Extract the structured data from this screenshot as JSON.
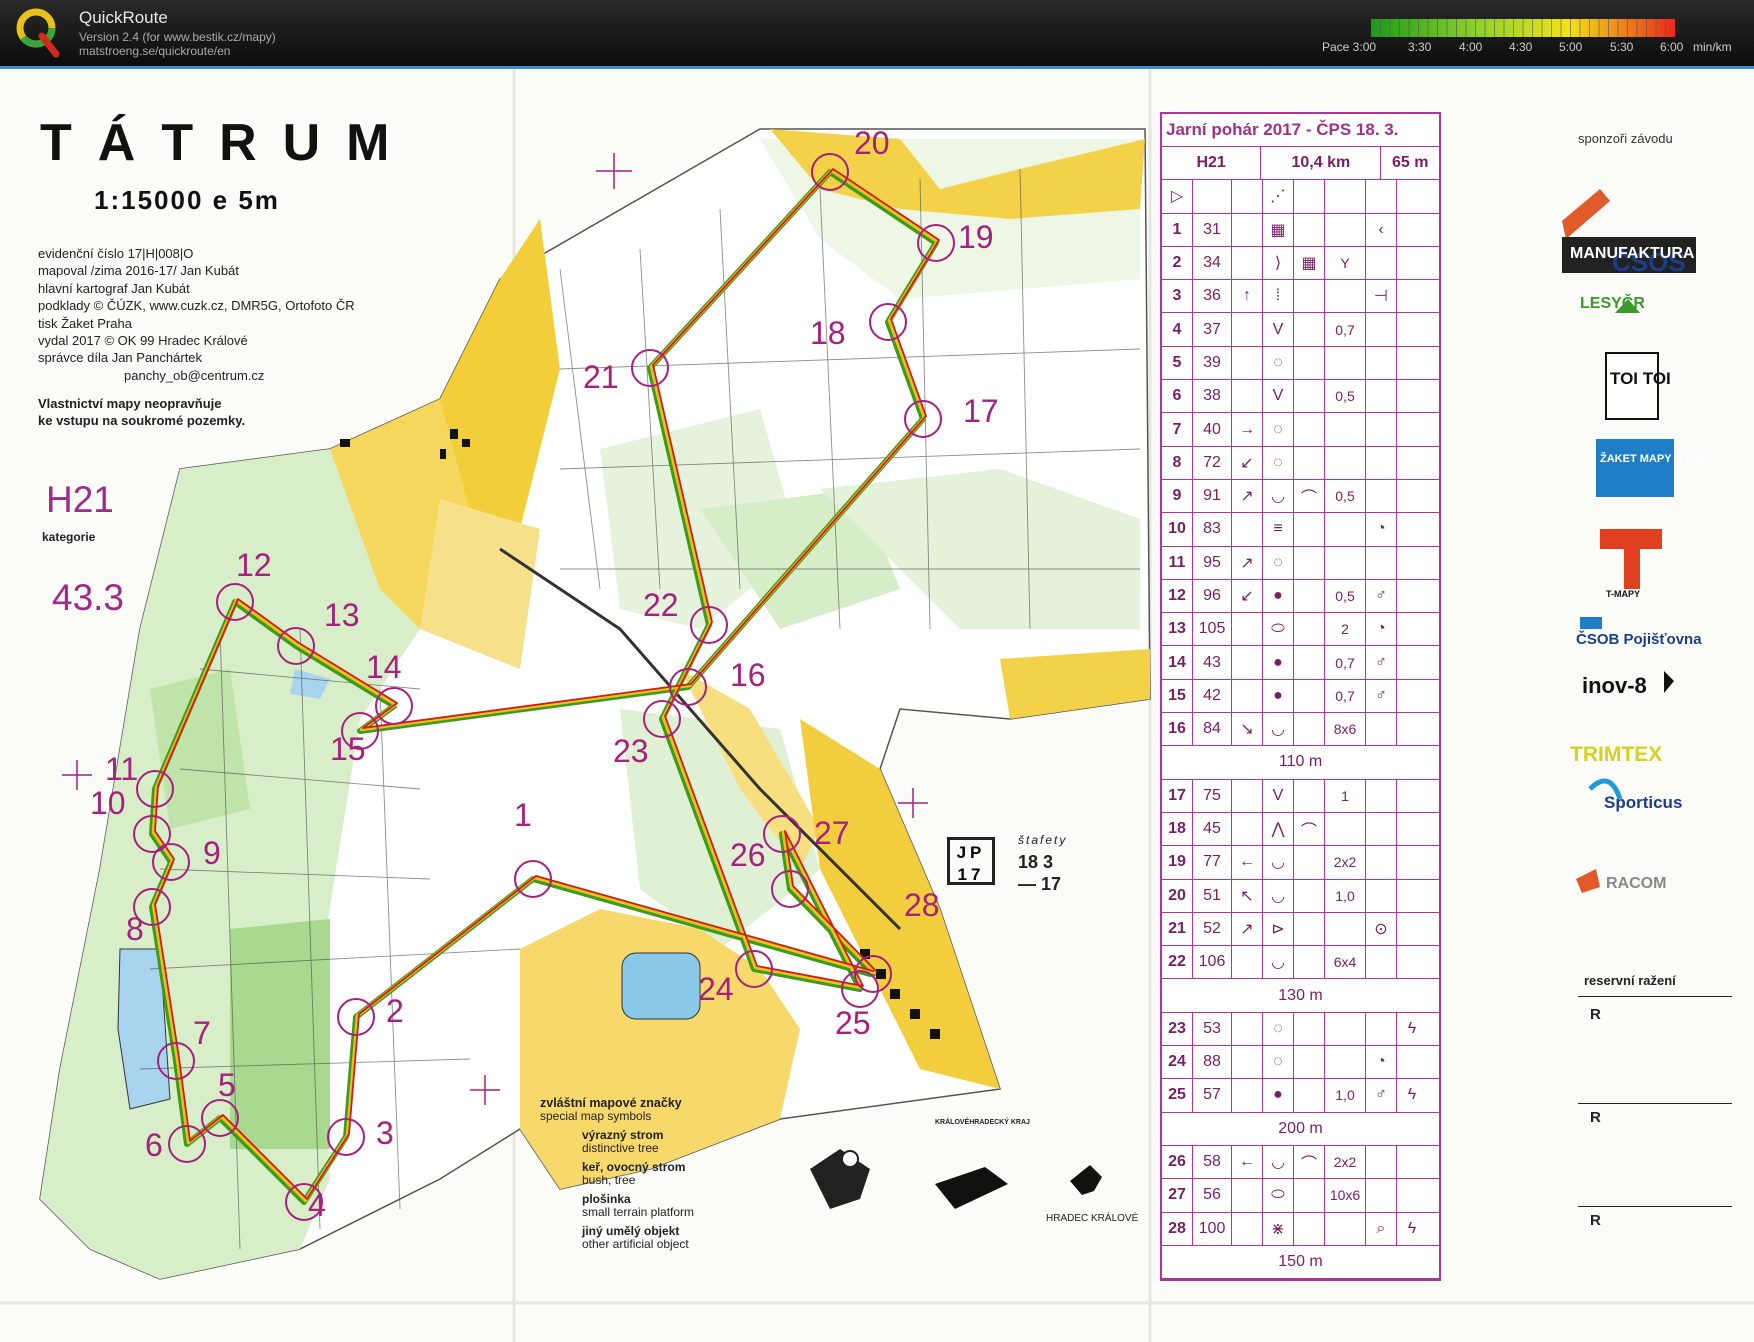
{
  "app": {
    "name": "QuickRoute",
    "version": "Version 2.4  (for www.bestik.cz/mapy)",
    "url": "matstroeng.se/quickroute/en",
    "pace_labels": [
      "Pace 3:00",
      "3:30",
      "4:00",
      "4:30",
      "5:00",
      "5:30",
      "6:00",
      "min/km"
    ]
  },
  "map": {
    "title": "TÁTRUM",
    "scale": "1:15000  e 5m",
    "credits": [
      "evidenční číslo 17|H|008|O",
      "mapoval /zima 2016-17/ Jan Kubát",
      "hlavní kartograf Jan Kubát",
      "podklady © ČÚZK, www.cuzk.cz, DMR5G, Ortofoto ČR",
      "tisk Žaket Praha",
      "vydal 2017  © OK 99 Hradec Králové",
      "správce díla  Jan Panchártek",
      "panchy_ob@centrum.cz"
    ],
    "warning": [
      "Vlastnictví mapy neopravňuje",
      "ke vstupu na soukromé pozemky."
    ],
    "category": "H21",
    "category_label": "kategorie",
    "time_value": "43.3",
    "control_numbers": [
      "1",
      "2",
      "3",
      "4",
      "5",
      "6",
      "7",
      "8",
      "9",
      "10",
      "11",
      "12",
      "13",
      "14",
      "15",
      "16",
      "17",
      "18",
      "19",
      "20",
      "21",
      "22",
      "23",
      "24",
      "25",
      "26",
      "27",
      "28"
    ],
    "jp_box": [
      "JP",
      "17"
    ],
    "stafety": [
      "štafety",
      "18  3",
      "—  17"
    ]
  },
  "legend": {
    "title": "zvláštní mapové značky",
    "subtitle": "special map symbols",
    "items": [
      {
        "cz": "výrazný strom",
        "en": "distinctive tree"
      },
      {
        "cz": "keř, ovocný strom",
        "en": "bush, tree"
      },
      {
        "cz": "plošinka",
        "en": "small terrain platform"
      },
      {
        "cz": "jiný umělý objekt",
        "en": "other artificial object"
      }
    ],
    "logo_captions": [
      "KRÁLOVÉHRADECKÝ KRAJ",
      "HRADEC KRÁLOVÉ"
    ]
  },
  "description_sheet": {
    "title": "Jarní pohár 2017 - ČPS 18. 3.",
    "category": "H21",
    "length": "10,4 km",
    "climb": "65 m",
    "rows": [
      {
        "n": "1",
        "code": "31",
        "c": "",
        "d": "▦",
        "e": "",
        "f": "",
        "g": "‹",
        "h": ""
      },
      {
        "n": "2",
        "code": "34",
        "c": "",
        "d": "⟩",
        "e": "▦",
        "f": "Y",
        "g": "",
        "h": ""
      },
      {
        "n": "3",
        "code": "36",
        "c": "↑",
        "d": "⁞",
        "e": "",
        "f": "",
        "g": "⊣",
        "h": ""
      },
      {
        "n": "4",
        "code": "37",
        "c": "",
        "d": "V",
        "e": "",
        "f": "0,7",
        "g": "",
        "h": ""
      },
      {
        "n": "5",
        "code": "39",
        "c": "",
        "d": "◌",
        "e": "",
        "f": "",
        "g": "",
        "h": ""
      },
      {
        "n": "6",
        "code": "38",
        "c": "",
        "d": "V",
        "e": "",
        "f": "0,5",
        "g": "",
        "h": ""
      },
      {
        "n": "7",
        "code": "40",
        "c": "→",
        "d": "◌",
        "e": "",
        "f": "",
        "g": "",
        "h": ""
      },
      {
        "n": "8",
        "code": "72",
        "c": "↙",
        "d": "◌",
        "e": "",
        "f": "",
        "g": "",
        "h": ""
      },
      {
        "n": "9",
        "code": "91",
        "c": "↗",
        "d": "◡",
        "e": "⌒",
        "f": "0,5",
        "g": "",
        "h": ""
      },
      {
        "n": "10",
        "code": "83",
        "c": "",
        "d": "≡",
        "e": "",
        "f": "",
        "g": "◔",
        "h": ""
      },
      {
        "n": "11",
        "code": "95",
        "c": "↗",
        "d": "◌",
        "e": "",
        "f": "",
        "g": "",
        "h": ""
      },
      {
        "n": "12",
        "code": "96",
        "c": "↙",
        "d": "●",
        "e": "",
        "f": "0,5",
        "g": "♂",
        "h": ""
      },
      {
        "n": "13",
        "code": "105",
        "c": "",
        "d": "⬭",
        "e": "",
        "f": "2",
        "g": "◔",
        "h": ""
      },
      {
        "n": "14",
        "code": "43",
        "c": "",
        "d": "●",
        "e": "",
        "f": "0,7",
        "g": "♂",
        "h": ""
      },
      {
        "n": "15",
        "code": "42",
        "c": "",
        "d": "●",
        "e": "",
        "f": "0,7",
        "g": "♂",
        "h": ""
      },
      {
        "n": "16",
        "code": "84",
        "c": "↘",
        "d": "◡",
        "e": "",
        "f": "8x6",
        "g": "",
        "h": ""
      },
      {
        "n": "",
        "code": "",
        "dist": "110 m"
      },
      {
        "n": "17",
        "code": "75",
        "c": "",
        "d": "V",
        "e": "",
        "f": "1",
        "g": "",
        "h": ""
      },
      {
        "n": "18",
        "code": "45",
        "c": "",
        "d": "⋀",
        "e": "⌒",
        "f": "",
        "g": "",
        "h": ""
      },
      {
        "n": "19",
        "code": "77",
        "c": "←",
        "d": "◡",
        "e": "",
        "f": "2x2",
        "g": "",
        "h": ""
      },
      {
        "n": "20",
        "code": "51",
        "c": "↖",
        "d": "◡",
        "e": "",
        "f": "1,0",
        "g": "",
        "h": ""
      },
      {
        "n": "21",
        "code": "52",
        "c": "↗",
        "d": "⊳",
        "e": "",
        "f": "",
        "g": "⊙",
        "h": ""
      },
      {
        "n": "22",
        "code": "106",
        "c": "",
        "d": "◡",
        "e": "",
        "f": "6x4",
        "g": "",
        "h": ""
      },
      {
        "n": "",
        "code": "",
        "dist": "130 m"
      },
      {
        "n": "23",
        "code": "53",
        "c": "",
        "d": "◌",
        "e": "",
        "f": "",
        "g": "",
        "h": "ϟ"
      },
      {
        "n": "24",
        "code": "88",
        "c": "",
        "d": "◌",
        "e": "",
        "f": "",
        "g": "◔",
        "h": ""
      },
      {
        "n": "25",
        "code": "57",
        "c": "",
        "d": "●",
        "e": "",
        "f": "1,0",
        "g": "♂",
        "h": "ϟ"
      },
      {
        "n": "",
        "code": "",
        "dist": "200 m"
      },
      {
        "n": "26",
        "code": "58",
        "c": "←",
        "d": "◡",
        "e": "⌒",
        "f": "2x2",
        "g": "",
        "h": ""
      },
      {
        "n": "27",
        "code": "56",
        "c": "",
        "d": "⬭",
        "e": "",
        "f": "10x6",
        "g": "",
        "h": ""
      },
      {
        "n": "28",
        "code": "100",
        "c": "",
        "d": "⋇",
        "e": "",
        "f": "",
        "g": "⌕",
        "h": "ϟ"
      },
      {
        "n": "",
        "code": "",
        "dist": "150 m"
      }
    ]
  },
  "sponsors": {
    "title": "sponzoři závodu",
    "names": [
      "ČSOS",
      "MANUFAKTURA",
      "LESYČR",
      "TOI TOI",
      "ŽAKET MAPY A TISK",
      "T-MAPY",
      "ČSOB Pojišťovna",
      "inov-8",
      "TRIMTEX",
      "Sporticus",
      "RACOM"
    ],
    "reserve_title": "reservní ražení",
    "reserve_marks": [
      "R",
      "R",
      "R"
    ]
  },
  "colors": {
    "course": "#a6207f",
    "route_red": "#d11a1a",
    "route_green": "#3c9a1e",
    "route_yellow": "#e6c21a",
    "header_accent": "#3c8fd4"
  }
}
